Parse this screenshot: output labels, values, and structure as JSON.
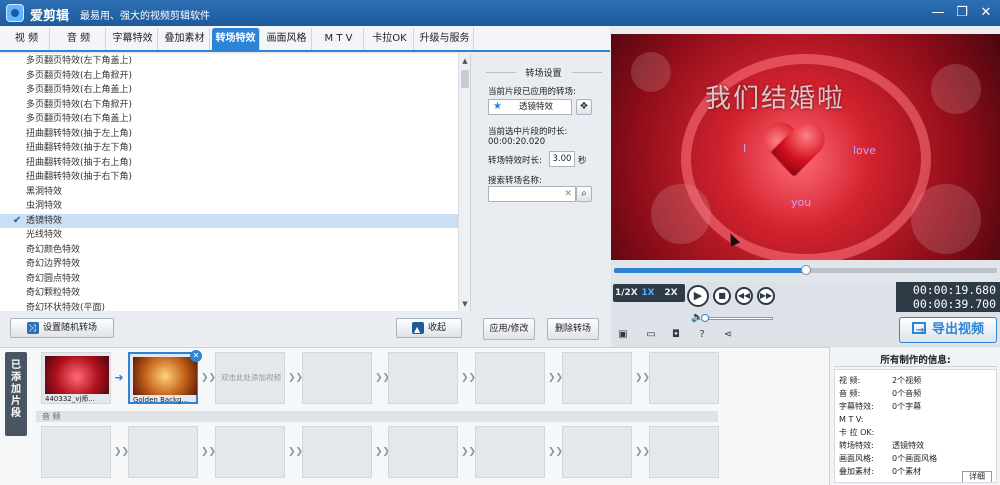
{
  "window": {
    "title": "爱剪辑",
    "slogan": "最易用、强大的视频剪辑软件",
    "buttons": [
      "—",
      "❐",
      "✕"
    ]
  },
  "menu": {
    "tabs": [
      "视 频",
      "音 频",
      "字幕特效",
      "叠加素材",
      "转场特效",
      "画面风格",
      "M T V",
      "卡拉OK",
      "升级与服务"
    ],
    "active_tab": "转场特效"
  },
  "effects": {
    "items": [
      "多页翻页特效(左下角盖上)",
      "多页翻页特效(右上角掀开)",
      "多页翻页特效(右上角盖上)",
      "多页翻页特效(右下角掀开)",
      "多页翻页特效(右下角盖上)",
      "扭曲翻转特效(抽于左上角)",
      "扭曲翻转特效(抽于左下角)",
      "扭曲翻转特效(抽于右上角)",
      "扭曲翻转特效(抽于右下角)",
      "黑洞特效",
      "虫洞特效",
      "透镜特效",
      "光线特效",
      "奇幻颜色特效",
      "奇幻边界特效",
      "奇幻圆点特效",
      "奇幻颗粒特效",
      "奇幻环状特效(平面)"
    ],
    "selected_index": 11
  },
  "list_actions": {
    "random_label": "设置随机转场",
    "collapse_label": "收起"
  },
  "settings": {
    "title": "转场设置",
    "applied_label": "当前片段已应用的转场:",
    "applied_value": "透镜特效",
    "duration_label": "当前选中片段的时长:",
    "duration_value": "00:00:20.020",
    "effect_duration_label": "转场特效时长:",
    "effect_duration_value": "3.00",
    "effect_duration_unit": "秒",
    "search_label": "搜索转场名称:",
    "search_value": "",
    "apply_label": "应用/修改",
    "delete_label": "删除转场"
  },
  "preview": {
    "headline": "我们结婚啦",
    "word_left": "I",
    "word_right": "love",
    "word_bottom": "you"
  },
  "playback": {
    "progress": 0.5,
    "speeds": [
      "1/2X",
      "1X",
      "2X"
    ],
    "active_speed": "1X",
    "current_time": "00:00:19.680",
    "total_time": "00:00:39.700",
    "volume": 0.02,
    "export_label": "导出视频"
  },
  "clips": {
    "side_label": "已添加片段",
    "items": [
      {
        "caption": "440332_vj师..."
      },
      {
        "caption": "Golden Backg..."
      }
    ],
    "drop_hint": "双击此处添加视频",
    "audio_label": "音 频"
  },
  "info": {
    "title": "所有制作的信息:",
    "rows": [
      {
        "key": "视 频:",
        "value": "2个视频"
      },
      {
        "key": "音 频:",
        "value": "0个音频"
      },
      {
        "key": "字幕特效:",
        "value": "0个字幕"
      },
      {
        "key": "M T V:",
        "value": ""
      },
      {
        "key": "卡 拉 OK:",
        "value": ""
      },
      {
        "key": "转场特效:",
        "value": "透镜特效"
      },
      {
        "key": "画面风格:",
        "value": "0个画面风格"
      },
      {
        "key": "叠加素材:",
        "value": "0个素材"
      }
    ],
    "detail_label": "详细"
  }
}
